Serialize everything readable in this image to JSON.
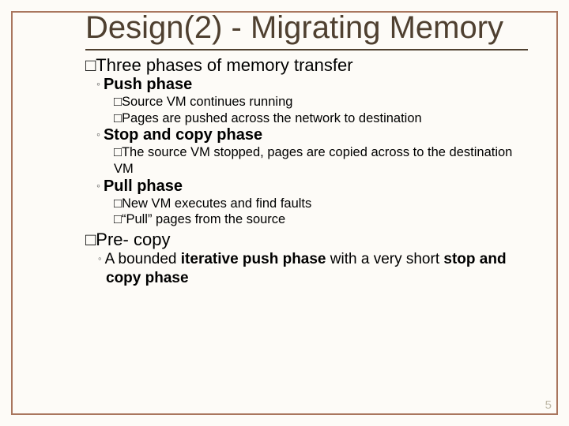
{
  "title": "Design(2)  - Migrating Memory",
  "bullet1": "Three phases of memory transfer",
  "phase1": {
    "name": "Push phase",
    "l1": "Source VM continues running",
    "l2": "Pages are pushed across the network to destination"
  },
  "phase2": {
    "name": "Stop and copy phase",
    "l1": "The source VM stopped, pages are copied across to the destination VM"
  },
  "phase3": {
    "name": "Pull phase",
    "l1": "New VM executes and find faults",
    "l2": "“Pull” pages from the source"
  },
  "bullet2": "Pre- copy",
  "body_pre": "A bounded ",
  "body_b1": "iterative push phase",
  "body_mid": " with a very short ",
  "body_b2": "stop and copy phase",
  "page": "5"
}
